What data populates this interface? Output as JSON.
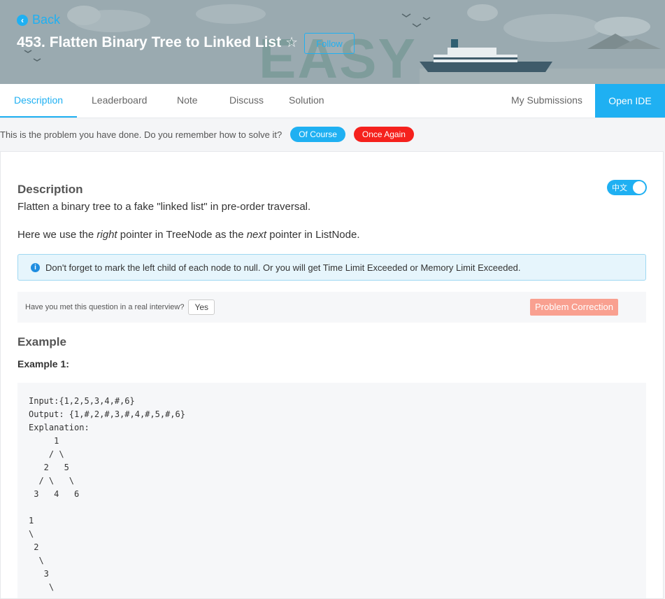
{
  "header": {
    "back_label": "Back",
    "title": "453. Flatten Binary Tree to Linked List",
    "follow_label": "Follow",
    "difficulty": "EASY"
  },
  "tabs": [
    {
      "label": "Description",
      "active": true
    },
    {
      "label": "Leaderboard"
    },
    {
      "label": "Note"
    },
    {
      "label": "Discuss"
    },
    {
      "label": "Solution"
    }
  ],
  "my_submissions_label": "My Submissions",
  "open_ide_label": "Open IDE",
  "done_bar": {
    "text": "This is the problem you have done. Do you remember how to solve it?",
    "of_course": "Of Course",
    "once_again": "Once Again"
  },
  "content": {
    "description_heading": "Description",
    "lang_toggle": "中文",
    "p1": "Flatten a binary tree to a fake \"linked list\" in pre-order traversal.",
    "p2_a": "Here we use the ",
    "p2_b": "right",
    "p2_c": " pointer in TreeNode as the ",
    "p2_d": "next",
    "p2_e": " pointer in ListNode.",
    "notice": "Don't forget to mark the left child of each node to null. Or you will get Time Limit Exceeded or Memory Limit Exceeded.",
    "interview_question": "Have you met this question in a real interview?",
    "yes_label": "Yes",
    "problem_correction": "Problem Correction",
    "example_heading": "Example",
    "example1_heading": "Example 1:",
    "code": "Input:{1,2,5,3,4,#,6}\nOutput: {1,#,2,#,3,#,4,#,5,#,6}\nExplanation:\n     1\n    / \\\n   2   5\n  / \\   \\\n 3   4   6\n\n1\n\\\n 2\n  \\\n   3\n    \\"
  },
  "colors": {
    "accent": "#1fb0f2",
    "danger": "#f5211d",
    "correction": "#f9a090",
    "banner": "#9aaab0"
  }
}
